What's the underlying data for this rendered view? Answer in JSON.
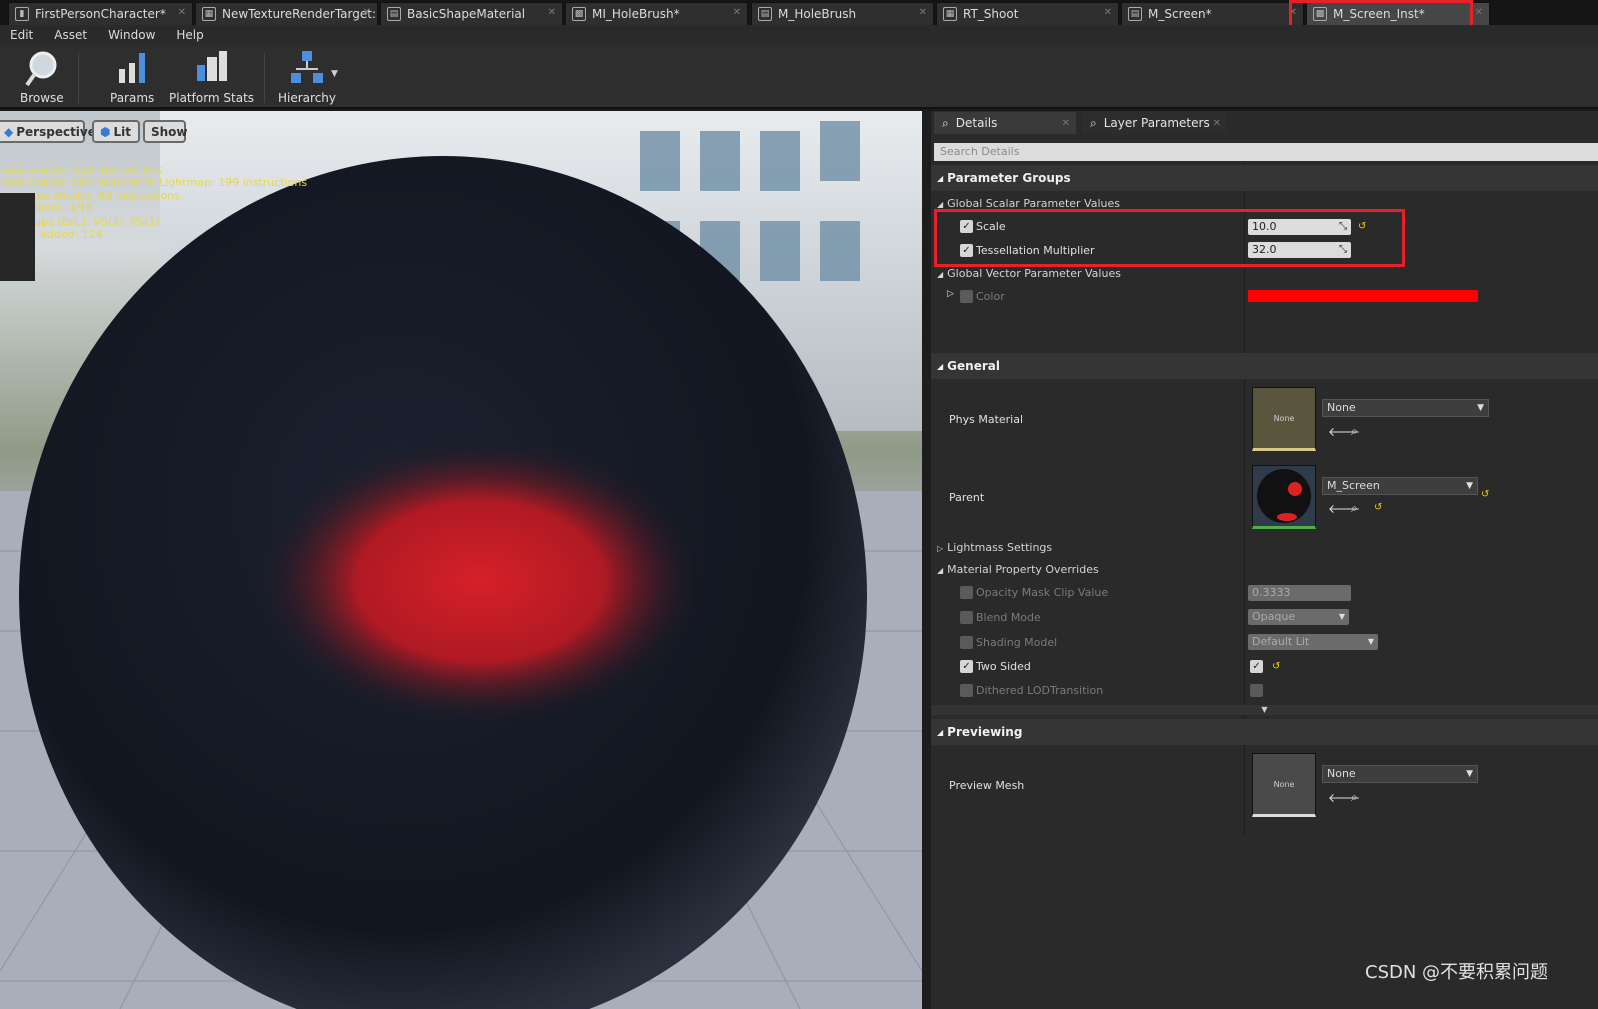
{
  "tabs": [
    {
      "label": "FirstPersonCharacter*",
      "icon": "blueprint-icon"
    },
    {
      "label": "NewTextureRenderTarget:",
      "icon": "texture-icon"
    },
    {
      "label": "BasicShapeMaterial",
      "icon": "material-icon"
    },
    {
      "label": "MI_HoleBrush*",
      "icon": "material-instance-icon"
    },
    {
      "label": "M_HoleBrush",
      "icon": "material-icon"
    },
    {
      "label": "RT_Shoot",
      "icon": "texture-icon"
    },
    {
      "label": "M_Screen*",
      "icon": "material-icon"
    },
    {
      "label": "M_Screen_Inst*",
      "icon": "material-instance-icon"
    }
  ],
  "menu": [
    "Edit",
    "Asset",
    "Window",
    "Help"
  ],
  "toolbar": {
    "browse": "Browse",
    "params": "Params",
    "platform_stats": "Platform Stats",
    "hierarchy": "Hierarchy"
  },
  "viewport": {
    "perspective": "Perspective",
    "lit": "Lit",
    "show": "Show",
    "stats": [
      "pass shader: 125 instructions",
      "pass shader with Volumetric Lightmap: 199 instructions",
      "rtex shader: 43 instructions",
      "blers: 4/16",
      "ups (Est.): VS(1), PS(1)",
      "added: 124"
    ]
  },
  "panel": {
    "tab_details": "Details",
    "tab_layer": "Layer Parameters",
    "search_placeholder": "Search Details",
    "parameter_groups": "Parameter Groups",
    "global_scalar": "Global Scalar Parameter Values",
    "scale_label": "Scale",
    "scale_value": "10.0",
    "tess_label": "Tessellation Multiplier",
    "tess_value": "32.0",
    "global_vector": "Global Vector Parameter Values",
    "color_label": "Color",
    "color_value": "#ff0000",
    "general": "General",
    "phys_material": "Phys Material",
    "phys_thumb": "None",
    "phys_value": "None",
    "parent": "Parent",
    "parent_value": "M_Screen",
    "lightmass": "Lightmass Settings",
    "overrides": "Material Property Overrides",
    "opacity_label": "Opacity Mask Clip Value",
    "opacity_value": "0.3333",
    "blend_label": "Blend Mode",
    "blend_value": "Opaque",
    "shading_label": "Shading Model",
    "shading_value": "Default Lit",
    "twosided_label": "Two Sided",
    "dithered_label": "Dithered LODTransition",
    "previewing": "Previewing",
    "preview_mesh": "Preview Mesh",
    "preview_thumb": "None",
    "preview_value": "None"
  },
  "watermark": "CSDN @不要积累问题",
  "colors": {
    "highlight": "#e8202a",
    "red_param": "#ff0000",
    "reset_arrow": "#e8d400"
  }
}
